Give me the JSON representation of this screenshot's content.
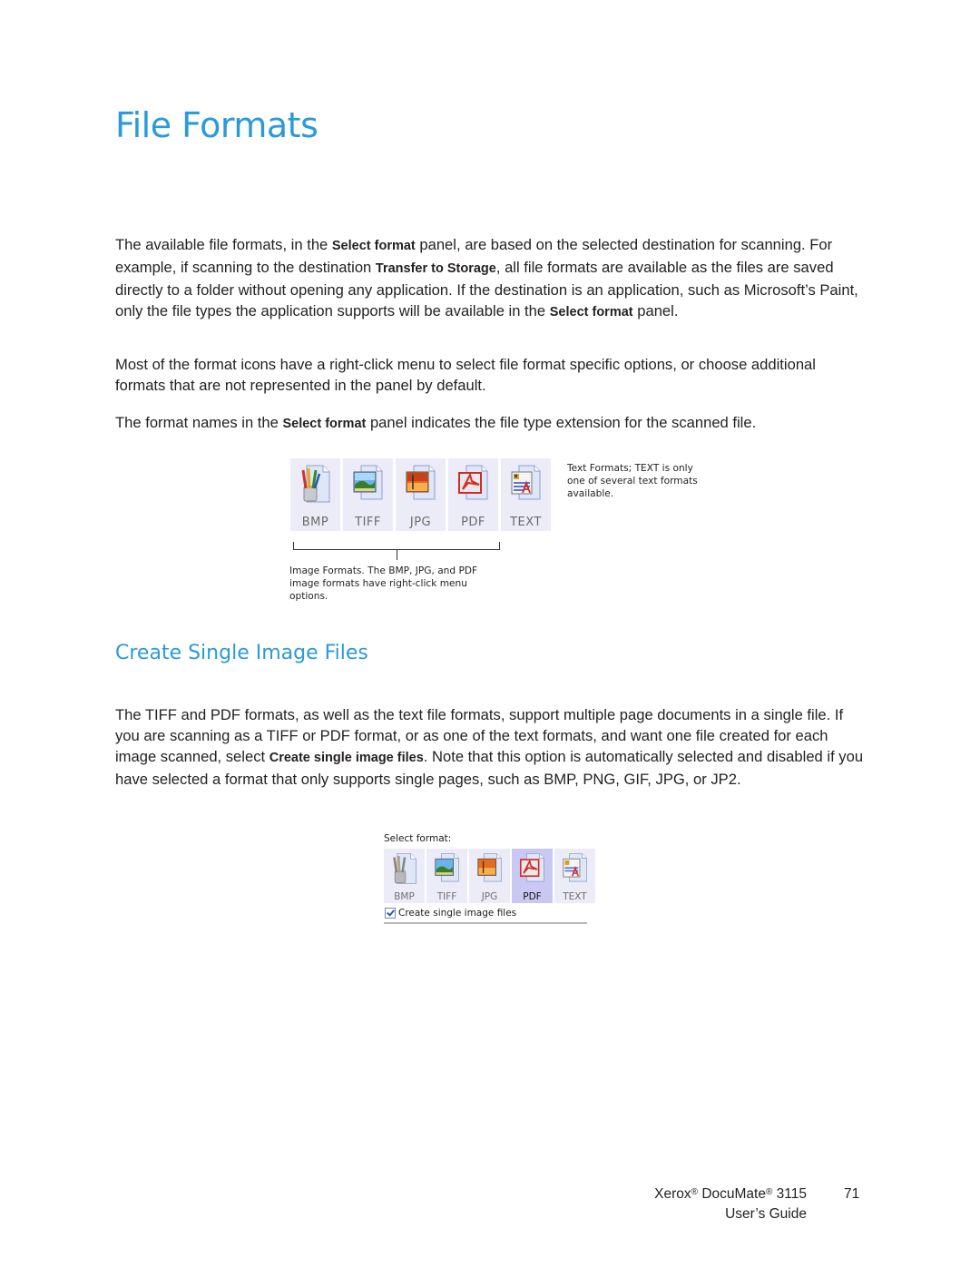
{
  "page": {
    "title": "File Formats",
    "paragraphs": {
      "p1": {
        "t1": "The available file formats, in the ",
        "b1": "Select format",
        "t2": " panel, are based on the selected destination for scanning. For example, if scanning to the destination ",
        "b2": "Transfer to Storage",
        "t3": ", all file formats are available as the files are saved directly to a folder without opening any application. If the destination is an application, such as Microsoft’s Paint, only the file types the application supports will be available in the ",
        "b3": "Select format",
        "t4": " panel."
      },
      "p2": "Most of the format icons have a right-click menu to select file format specific options, or choose additional formats that are not represented in the panel by default.",
      "p3": {
        "t1": "The format names in the ",
        "b1": "Select format",
        "t2": " panel indicates the file type extension for the scanned file."
      }
    },
    "figure1": {
      "formats": [
        {
          "label": "BMP",
          "icon": "bmp-paint-icon"
        },
        {
          "label": "TIFF",
          "icon": "tiff-landscape-icon"
        },
        {
          "label": "JPG",
          "icon": "jpg-sunset-icon"
        },
        {
          "label": "PDF",
          "icon": "pdf-acrobat-icon"
        },
        {
          "label": "TEXT",
          "icon": "text-document-icon"
        }
      ],
      "text_caption": "Text Formats; TEXT is only one of several text formats available.",
      "image_caption": "Image Formats. The BMP, JPG, and PDF image formats have right-click menu options."
    },
    "section2": {
      "heading": "Create Single Image Files",
      "p4": {
        "t1": "The TIFF and PDF formats, as well as the text file formats, support multiple page documents in a single file. If you are scanning as a TIFF or PDF format, or as one of the text formats, and want one file created for each image scanned, select ",
        "b1": "Create single image files",
        "t2": ". Note that this option is automatically selected and disabled if you have selected a format that only supports single pages, such as BMP, PNG, GIF, JPG, or JP2."
      }
    },
    "figure2": {
      "label": "Select format:",
      "formats": [
        {
          "label": "BMP",
          "selected": false
        },
        {
          "label": "TIFF",
          "selected": false
        },
        {
          "label": "JPG",
          "selected": false
        },
        {
          "label": "PDF",
          "selected": true
        },
        {
          "label": "TEXT",
          "selected": false
        }
      ],
      "checkbox_label": "Create single image files",
      "checkbox_checked": true
    },
    "footer": {
      "brand": "Xerox",
      "reg": "®",
      "product": " DocuMate",
      "model": " 3115",
      "guide": "User’s Guide",
      "page_number": "71"
    },
    "colors": {
      "heading": "#2b9ad8",
      "body_text": "#231f20",
      "tile_bg": "#ececf9",
      "tile_selected_bg": "#c8c8f2"
    }
  }
}
